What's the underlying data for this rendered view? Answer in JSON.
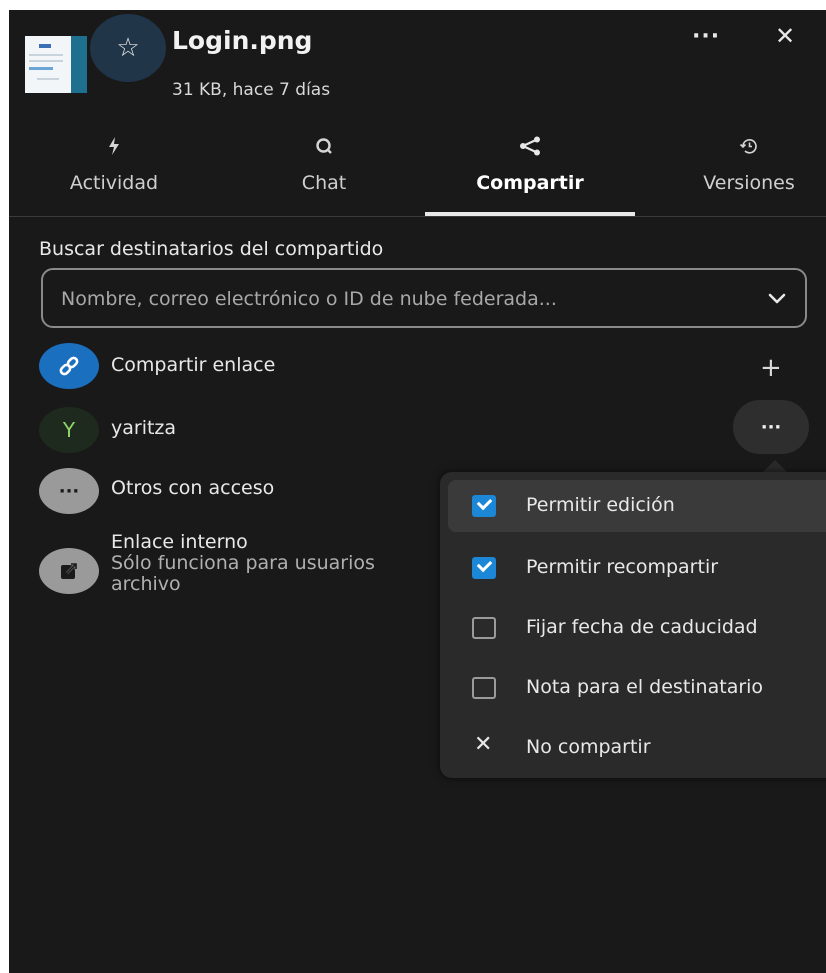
{
  "header": {
    "file_name": "Login.png",
    "file_meta": "31 KB, hace 7 días"
  },
  "tabs": [
    {
      "label": "Actividad",
      "icon": "bolt-icon"
    },
    {
      "label": "Chat",
      "icon": "chat-icon"
    },
    {
      "label": "Compartir",
      "icon": "share-icon",
      "active": true
    },
    {
      "label": "Versiones",
      "icon": "history-icon"
    }
  ],
  "search": {
    "label": "Buscar destinatarios del compartido",
    "placeholder": "Nombre, correo electrónico o ID de nube federada..."
  },
  "shares": {
    "link": {
      "label": "Compartir enlace"
    },
    "user": {
      "initial": "Y",
      "name": "yaritza"
    },
    "others": {
      "label": "Otros con acceso"
    },
    "internal": {
      "title": "Enlace interno",
      "desc_line1": "Sólo funciona para usuarios",
      "desc_line2": "archivo"
    }
  },
  "menu": {
    "items": [
      {
        "label": "Permitir edición",
        "checked": true
      },
      {
        "label": "Permitir recompartir",
        "checked": true
      },
      {
        "label": "Fijar fecha de caducidad",
        "checked": false
      },
      {
        "label": "Nota para el destinatario",
        "checked": false
      },
      {
        "label": "No compartir"
      }
    ]
  },
  "colors": {
    "background": "#191919",
    "accent": "#1b87d6",
    "menu_background": "#2a2a2a"
  }
}
